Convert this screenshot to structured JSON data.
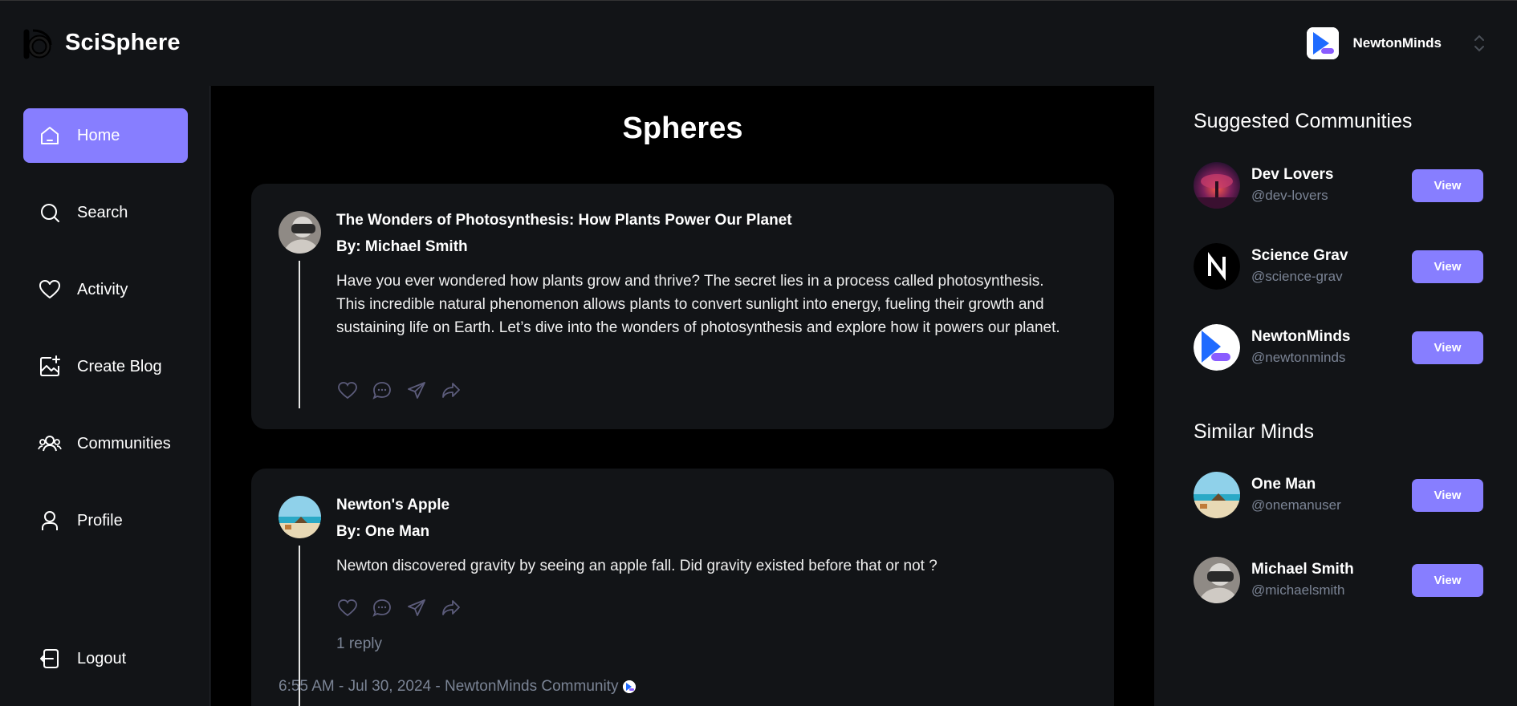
{
  "app": {
    "name": "SciSphere"
  },
  "org_switcher": {
    "name": "NewtonMinds"
  },
  "sidebar": {
    "items": [
      {
        "label": "Home",
        "icon": "home-icon",
        "active": true
      },
      {
        "label": "Search",
        "icon": "search-icon",
        "active": false
      },
      {
        "label": "Activity",
        "icon": "heart-icon",
        "active": false
      },
      {
        "label": "Create Blog",
        "icon": "image-plus-icon",
        "active": false
      },
      {
        "label": "Communities",
        "icon": "users-icon",
        "active": false
      },
      {
        "label": "Profile",
        "icon": "user-icon",
        "active": false
      }
    ],
    "logout_label": "Logout"
  },
  "main": {
    "title": "Spheres",
    "posts": [
      {
        "title": "The Wonders of Photosynthesis: How Plants Power Our Planet",
        "author": "By: Michael Smith",
        "body": "Have you ever wondered how plants grow and thrive? The secret lies in a process called photosynthesis. This incredible natural phenomenon allows plants to convert sunlight into energy, fueling their growth and sustaining life on Earth. Let’s dive into the wonders of photosynthesis and explore how it powers our planet."
      },
      {
        "title": "Newton's Apple",
        "author": "By: One Man",
        "body": "Newton discovered gravity by seeing an apple fall. Did gravity existed before that or not ?",
        "replies": "1 reply",
        "meta": "6:55 AM - Jul 30, 2024 - NewtonMinds Community"
      }
    ]
  },
  "rightbar": {
    "suggested_title": "Suggested Communities",
    "communities": [
      {
        "name": "Dev Lovers",
        "handle": "@dev-lovers",
        "button": "View"
      },
      {
        "name": "Science Grav",
        "handle": "@science-grav",
        "button": "View"
      },
      {
        "name": "NewtonMinds",
        "handle": "@newtonminds",
        "button": "View"
      }
    ],
    "similar_title": "Similar Minds",
    "users": [
      {
        "name": "One Man",
        "handle": "@onemanuser",
        "button": "View"
      },
      {
        "name": "Michael Smith",
        "handle": "@michaelsmith",
        "button": "View"
      }
    ]
  },
  "colors": {
    "accent": "#877eff",
    "background": "#121417",
    "feed_bg": "#000000",
    "muted": "#7b8495"
  }
}
